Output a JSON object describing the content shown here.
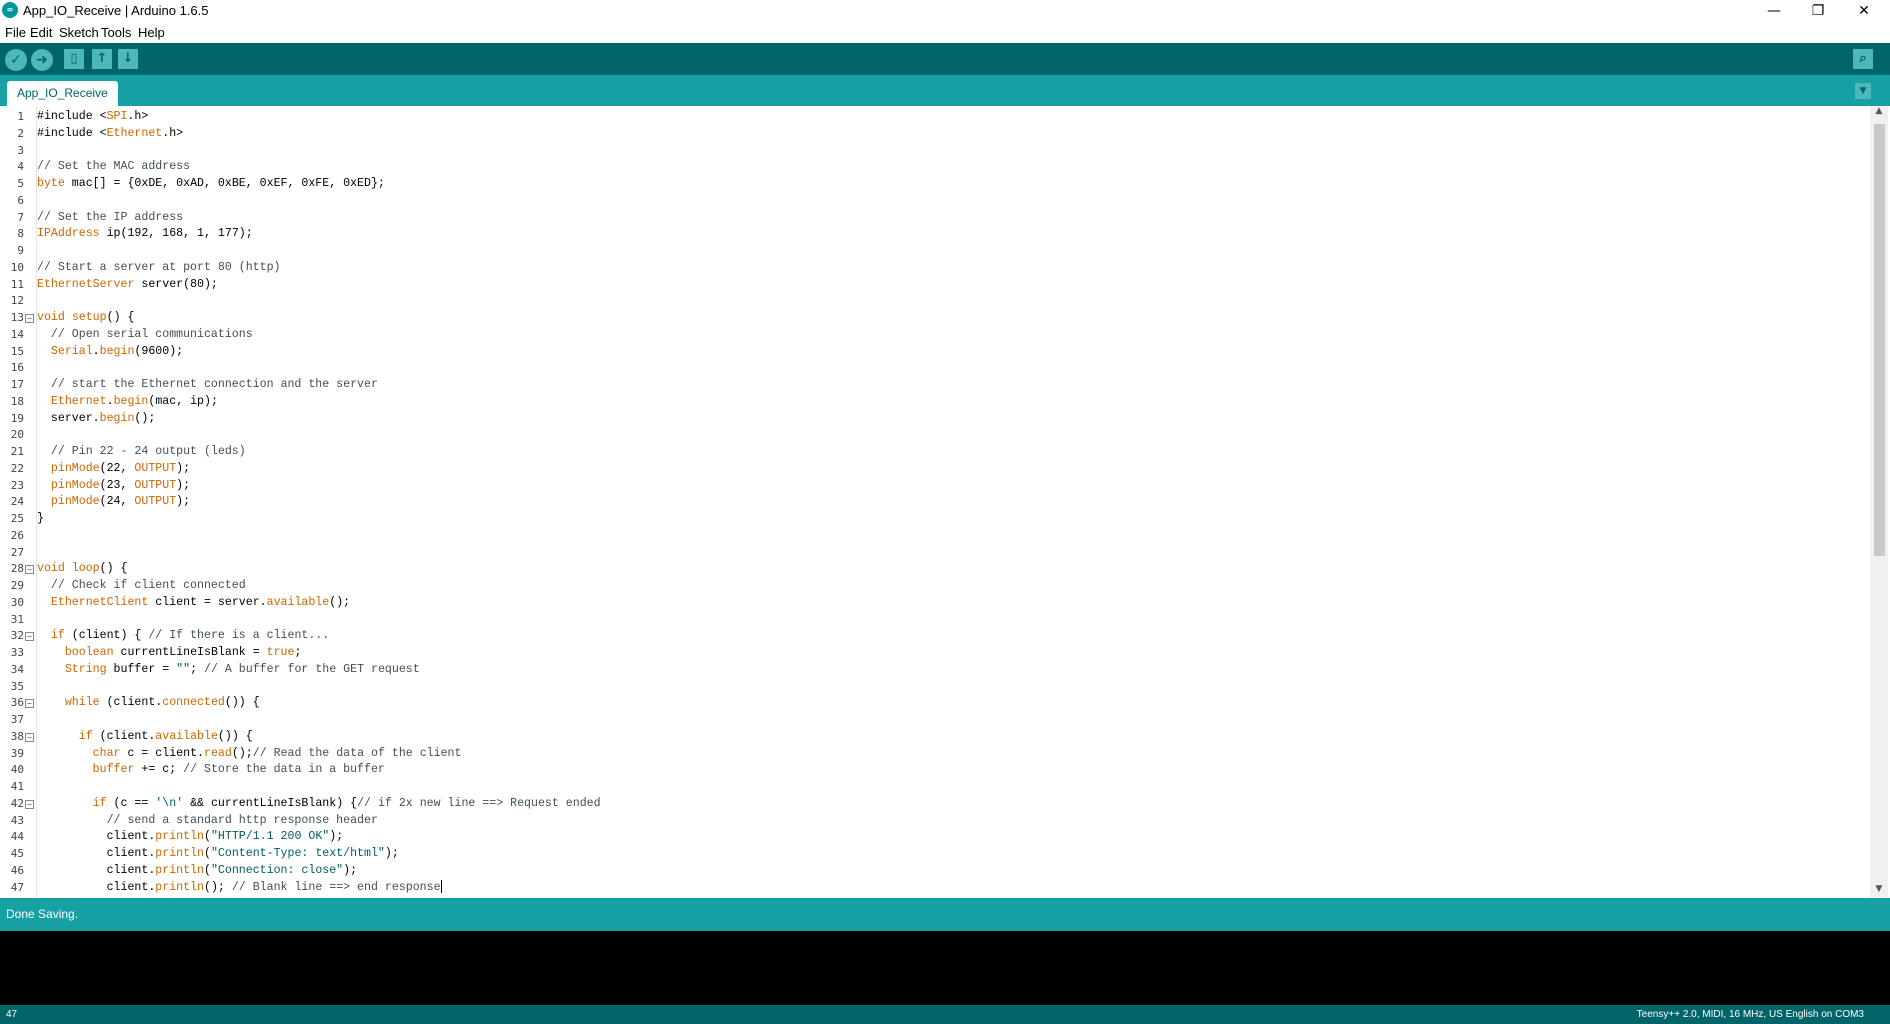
{
  "window": {
    "title": "App_IO_Receive | Arduino 1.6.5",
    "logo_text": "∞",
    "controls": {
      "minimize": "—",
      "maximize": "❐",
      "close": "✕"
    }
  },
  "menu": {
    "items": [
      "File",
      "Edit",
      "Sketch",
      "Tools",
      "Help"
    ]
  },
  "toolbar": {
    "verify_icon": "check-icon",
    "upload_icon": "right-arrow-icon",
    "new_icon": "new-file-icon",
    "open_icon": "up-arrow-icon",
    "save_icon": "down-arrow-icon",
    "serial_monitor_icon": "magnifier-icon"
  },
  "tabs": [
    {
      "label": "App_IO_Receive",
      "active": true
    }
  ],
  "editor": {
    "lines": [
      "1",
      "2",
      "3",
      "4",
      "5",
      "6",
      "7",
      "8",
      "9",
      "10",
      "11",
      "12",
      "13",
      "14",
      "15",
      "16",
      "17",
      "18",
      "19",
      "20",
      "21",
      "22",
      "23",
      "24",
      "25",
      "26",
      "27",
      "28",
      "29",
      "30",
      "31",
      "32",
      "33",
      "34",
      "35",
      "36",
      "37",
      "38",
      "39",
      "40",
      "41",
      "42",
      "43",
      "44",
      "45",
      "46",
      "47"
    ],
    "fold_lines": [
      13,
      28,
      32,
      36,
      38,
      42
    ],
    "code": [
      [
        {
          "t": "#include <"
        },
        {
          "t": "SPI",
          "c": "ty"
        },
        {
          "t": ".h>"
        }
      ],
      [
        {
          "t": "#include <"
        },
        {
          "t": "Ethernet",
          "c": "ty"
        },
        {
          "t": ".h>"
        }
      ],
      [],
      [
        {
          "t": "// Set the MAC address",
          "c": "cm"
        }
      ],
      [
        {
          "t": "byte",
          "c": "kw"
        },
        {
          "t": " mac[] = {0xDE, 0xAD, 0xBE, 0xEF, 0xFE, 0xED};"
        }
      ],
      [],
      [
        {
          "t": "// Set the IP address",
          "c": "cm"
        }
      ],
      [
        {
          "t": "IPAddress",
          "c": "ty"
        },
        {
          "t": " ip(192, 168, 1, 177);"
        }
      ],
      [],
      [
        {
          "t": "// Start a server at port 80 (http)",
          "c": "cm"
        }
      ],
      [
        {
          "t": "EthernetServer",
          "c": "ty"
        },
        {
          "t": " server(80);"
        }
      ],
      [],
      [
        {
          "t": "void",
          "c": "kw"
        },
        {
          "t": " "
        },
        {
          "t": "setup",
          "c": "kw"
        },
        {
          "t": "() {"
        }
      ],
      [
        {
          "t": "  // Open serial communications",
          "c": "cm"
        }
      ],
      [
        {
          "t": "  "
        },
        {
          "t": "Serial",
          "c": "ty"
        },
        {
          "t": "."
        },
        {
          "t": "begin",
          "c": "kw"
        },
        {
          "t": "(9600);"
        }
      ],
      [],
      [
        {
          "t": "  // start the Ethernet connection and the server",
          "c": "cm"
        }
      ],
      [
        {
          "t": "  "
        },
        {
          "t": "Ethernet",
          "c": "ty"
        },
        {
          "t": "."
        },
        {
          "t": "begin",
          "c": "kw"
        },
        {
          "t": "(mac, ip);"
        }
      ],
      [
        {
          "t": "  server."
        },
        {
          "t": "begin",
          "c": "kw"
        },
        {
          "t": "();"
        }
      ],
      [],
      [
        {
          "t": "  // Pin 22 - 24 output (leds)",
          "c": "cm"
        }
      ],
      [
        {
          "t": "  "
        },
        {
          "t": "pinMode",
          "c": "kw"
        },
        {
          "t": "(22, "
        },
        {
          "t": "OUTPUT",
          "c": "ty"
        },
        {
          "t": ");"
        }
      ],
      [
        {
          "t": "  "
        },
        {
          "t": "pinMode",
          "c": "kw"
        },
        {
          "t": "(23, "
        },
        {
          "t": "OUTPUT",
          "c": "ty"
        },
        {
          "t": ");"
        }
      ],
      [
        {
          "t": "  "
        },
        {
          "t": "pinMode",
          "c": "kw"
        },
        {
          "t": "(24, "
        },
        {
          "t": "OUTPUT",
          "c": "ty"
        },
        {
          "t": ");"
        }
      ],
      [
        {
          "t": "}"
        }
      ],
      [],
      [],
      [
        {
          "t": "void",
          "c": "kw"
        },
        {
          "t": " "
        },
        {
          "t": "loop",
          "c": "kw"
        },
        {
          "t": "() {"
        }
      ],
      [
        {
          "t": "  // Check if client connected",
          "c": "cm"
        }
      ],
      [
        {
          "t": "  "
        },
        {
          "t": "EthernetClient",
          "c": "ty"
        },
        {
          "t": " client = server."
        },
        {
          "t": "available",
          "c": "kw"
        },
        {
          "t": "();"
        }
      ],
      [],
      [
        {
          "t": "  "
        },
        {
          "t": "if",
          "c": "kw"
        },
        {
          "t": " (client) { "
        },
        {
          "t": "// If there is a client...",
          "c": "cm"
        }
      ],
      [
        {
          "t": "    "
        },
        {
          "t": "boolean",
          "c": "kw"
        },
        {
          "t": " currentLineIsBlank = "
        },
        {
          "t": "true",
          "c": "kw"
        },
        {
          "t": ";"
        }
      ],
      [
        {
          "t": "    "
        },
        {
          "t": "String",
          "c": "ty"
        },
        {
          "t": " buffer = "
        },
        {
          "t": "\"\"",
          "c": "st"
        },
        {
          "t": "; "
        },
        {
          "t": "// A buffer for the GET request",
          "c": "cm"
        }
      ],
      [],
      [
        {
          "t": "    "
        },
        {
          "t": "while",
          "c": "kw"
        },
        {
          "t": " (client."
        },
        {
          "t": "connected",
          "c": "kw"
        },
        {
          "t": "()) {"
        }
      ],
      [],
      [
        {
          "t": "      "
        },
        {
          "t": "if",
          "c": "kw"
        },
        {
          "t": " (client."
        },
        {
          "t": "available",
          "c": "kw"
        },
        {
          "t": "()) {"
        }
      ],
      [
        {
          "t": "        "
        },
        {
          "t": "char",
          "c": "kw"
        },
        {
          "t": " c = client."
        },
        {
          "t": "read",
          "c": "kw"
        },
        {
          "t": "();"
        },
        {
          "t": "// Read the data of the client",
          "c": "cm"
        }
      ],
      [
        {
          "t": "        "
        },
        {
          "t": "buffer",
          "c": "kw"
        },
        {
          "t": " += c; "
        },
        {
          "t": "// Store the data in a buffer",
          "c": "cm"
        }
      ],
      [],
      [
        {
          "t": "        "
        },
        {
          "t": "if",
          "c": "kw"
        },
        {
          "t": " (c == "
        },
        {
          "t": "'\\n'",
          "c": "st"
        },
        {
          "t": " && currentLineIsBlank) {"
        },
        {
          "t": "// if 2x new line ==> Request ended",
          "c": "cm"
        }
      ],
      [
        {
          "t": "          // send a standard http response header",
          "c": "cm"
        }
      ],
      [
        {
          "t": "          client."
        },
        {
          "t": "println",
          "c": "kw"
        },
        {
          "t": "("
        },
        {
          "t": "\"HTTP/1.1 200 OK\"",
          "c": "st"
        },
        {
          "t": ");"
        }
      ],
      [
        {
          "t": "          client."
        },
        {
          "t": "println",
          "c": "kw"
        },
        {
          "t": "("
        },
        {
          "t": "\"Content-Type: text/html\"",
          "c": "st"
        },
        {
          "t": ");"
        }
      ],
      [
        {
          "t": "          client."
        },
        {
          "t": "println",
          "c": "kw"
        },
        {
          "t": "("
        },
        {
          "t": "\"Connection: close\"",
          "c": "st"
        },
        {
          "t": ");"
        }
      ],
      [
        {
          "t": "          client."
        },
        {
          "t": "println",
          "c": "kw"
        },
        {
          "t": "(); "
        },
        {
          "t": "// Blank line ==> end response",
          "c": "cm"
        }
      ]
    ],
    "caret_line": 47
  },
  "status": {
    "message": "Done Saving.",
    "current_line": "47",
    "board_info": "Teensy++ 2.0, MIDI, 16 MHz, US English on COM3"
  },
  "colors": {
    "toolbar": "#006468",
    "tabbar": "#17a1a5",
    "keyword": "#cc6600",
    "comment": "#434f54",
    "string": "#005c5f"
  }
}
